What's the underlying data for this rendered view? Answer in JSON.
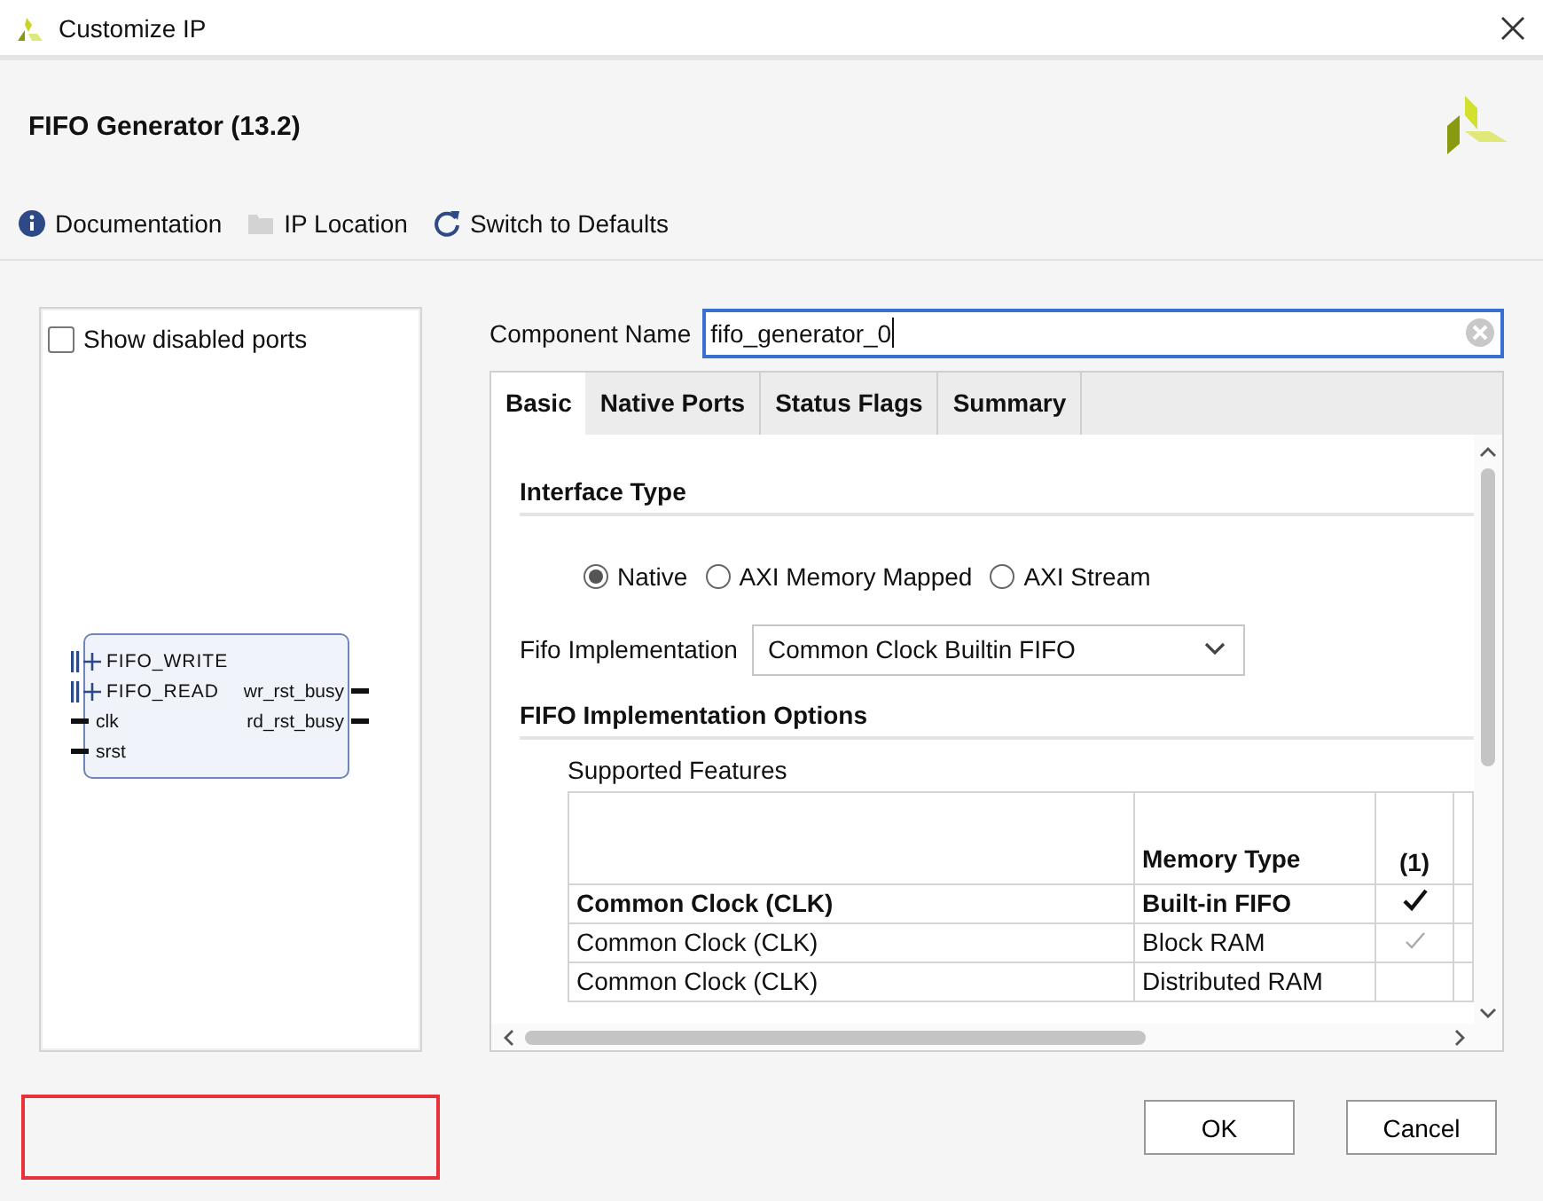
{
  "window": {
    "title": "Customize IP"
  },
  "header": {
    "title": "FIFO Generator (13.2)"
  },
  "toolbar": [
    {
      "label": "Documentation",
      "kind": "info",
      "disabled": false
    },
    {
      "label": "IP Location",
      "kind": "folder",
      "disabled": true
    },
    {
      "label": "Switch to Defaults",
      "kind": "refresh",
      "disabled": false
    }
  ],
  "left_panel": {
    "show_disabled_ports": {
      "label": "Show disabled ports",
      "checked": false
    },
    "symbol": {
      "rows": [
        {
          "left": {
            "label": "FIFO_WRITE",
            "kind": "bus"
          }
        },
        {
          "left": {
            "label": "FIFO_READ",
            "kind": "bus"
          },
          "right": "wr_rst_busy"
        },
        {
          "left": {
            "label": "clk",
            "kind": "wire"
          },
          "right": "rd_rst_busy"
        },
        {
          "left": {
            "label": "srst",
            "kind": "wire"
          }
        }
      ]
    }
  },
  "component_name": {
    "label": "Component Name",
    "value": "fifo_generator_0"
  },
  "tabs": [
    {
      "label": "Basic",
      "selected": true
    },
    {
      "label": "Native Ports",
      "selected": false
    },
    {
      "label": "Status Flags",
      "selected": false
    },
    {
      "label": "Summary",
      "selected": false
    }
  ],
  "interface_type": {
    "title": "Interface Type",
    "options": [
      {
        "label": "Native",
        "selected": true
      },
      {
        "label": "AXI Memory Mapped",
        "selected": false
      },
      {
        "label": "AXI Stream",
        "selected": false
      }
    ]
  },
  "fifo_implementation": {
    "label": "Fifo Implementation",
    "value": "Common Clock Builtin FIFO"
  },
  "implementation_options": {
    "title": "FIFO Implementation Options",
    "subtitle": "Supported Features",
    "table": {
      "columns": [
        "",
        "Memory Type",
        "(1)"
      ],
      "rows": [
        {
          "cells": [
            "Common Clock (CLK)",
            "Built-in FIFO"
          ],
          "selected": true,
          "kind": "full"
        },
        {
          "cells": [
            "Common Clock (CLK)",
            "Block RAM"
          ],
          "selected": false,
          "kind": "partial"
        },
        {
          "cells": [
            "Common Clock (CLK)",
            "Distributed RAM"
          ],
          "selected": false,
          "kind": "none"
        }
      ]
    }
  },
  "buttons": [
    {
      "label": "OK"
    },
    {
      "label": "Cancel"
    }
  ]
}
